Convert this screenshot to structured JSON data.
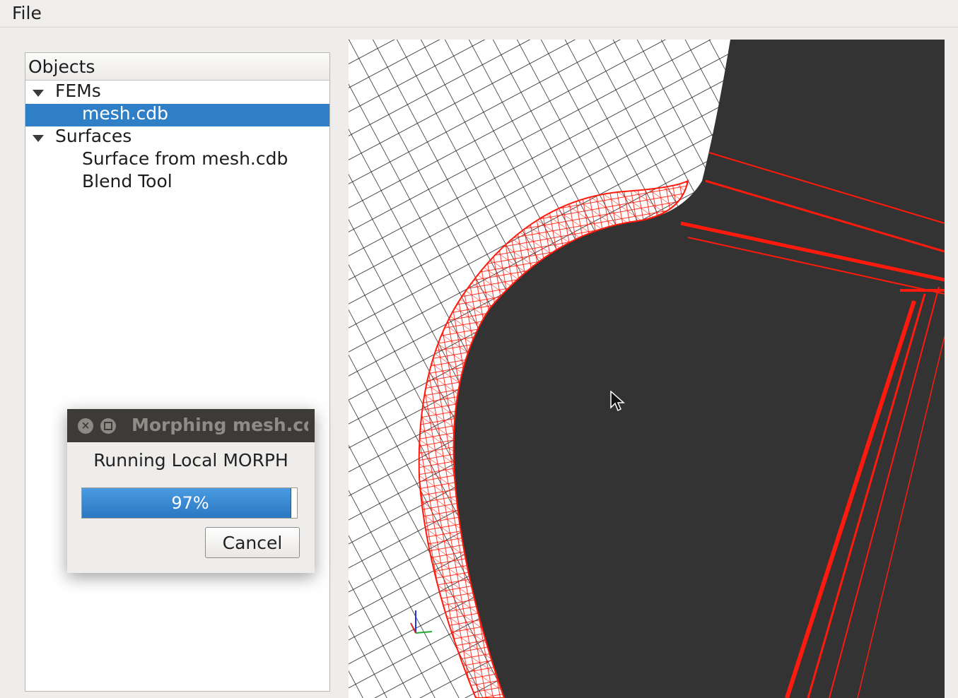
{
  "menubar": {
    "file_label": "File"
  },
  "objects_panel": {
    "header": "Objects",
    "tree": [
      {
        "label": "FEMs",
        "expanded": true,
        "selected": false
      },
      {
        "label": "mesh.cdb",
        "selected": true
      },
      {
        "label": "Surfaces",
        "expanded": true,
        "selected": false
      },
      {
        "label": "Surface from mesh.cdb",
        "selected": false
      },
      {
        "label": "Blend Tool",
        "selected": false
      }
    ]
  },
  "dialog": {
    "title": "Morphing mesh.cdb",
    "message": "Running Local MORPH",
    "progress_value": 97,
    "progress_text": "97%",
    "cancel_label": "Cancel",
    "close_icon": "close-icon",
    "maximize_icon": "maximize-icon"
  },
  "viewport": {
    "background_color": "#333333",
    "mesh_color": "#111111",
    "highlight_color": "#ff1a0d"
  },
  "colors": {
    "selection": "#2f7fc6",
    "progress": "#2f85d0"
  }
}
